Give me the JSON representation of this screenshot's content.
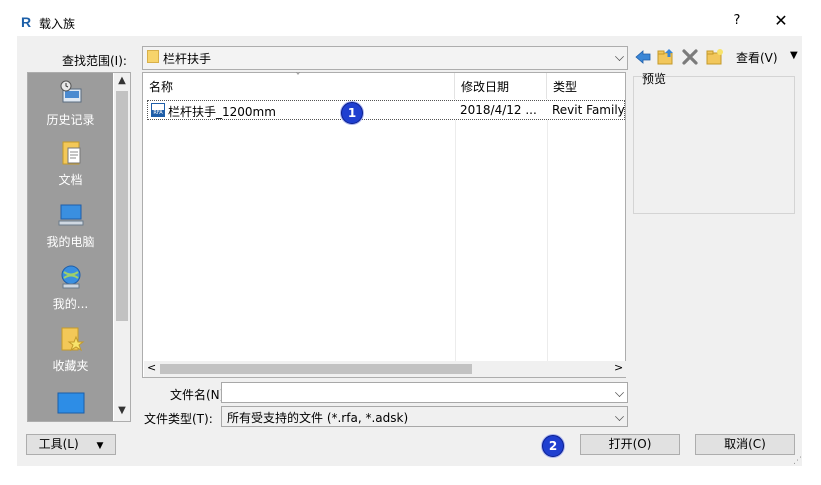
{
  "window": {
    "app_logo": "R",
    "title": "载入族",
    "help": "?",
    "close": "✕"
  },
  "look_in": {
    "label": "查找范围(I):",
    "value": "栏杆扶手"
  },
  "toolbar": {
    "back_icon": "back-arrow-icon",
    "up_icon": "up-folder-icon",
    "delete_icon": "delete-icon",
    "new_folder_icon": "new-folder-icon",
    "views_label": "查看(V)",
    "views_arrow": "▼"
  },
  "places": {
    "items": [
      {
        "label": "历史记录",
        "icon": "history-icon"
      },
      {
        "label": "文档",
        "icon": "documents-icon"
      },
      {
        "label": "我的电脑",
        "icon": "computer-icon"
      },
      {
        "label": "我的...",
        "icon": "network-icon"
      },
      {
        "label": "收藏夹",
        "icon": "favorites-icon"
      },
      {
        "label": "",
        "icon": "desktop-icon"
      }
    ],
    "scroll_up": "▲",
    "scroll_down": "▼"
  },
  "file_list": {
    "columns": [
      {
        "label": "名称"
      },
      {
        "label": "修改日期"
      },
      {
        "label": "类型"
      }
    ],
    "sort_indicator": "ˇ",
    "rows": [
      {
        "name": "栏杆扶手_1200mm",
        "date": "2018/4/12 ...",
        "type": "Revit Family",
        "icon_text": "RFA"
      }
    ],
    "scroll_left": "<",
    "scroll_right": ">"
  },
  "preview": {
    "label": "预览"
  },
  "file_name": {
    "label": "文件名(N):",
    "value": ""
  },
  "file_type": {
    "label": "文件类型(T):",
    "value": "所有受支持的文件 (*.rfa, *.adsk)"
  },
  "buttons": {
    "tools": "工具(L)",
    "tools_arrow": "▼",
    "open": "打开(O)",
    "cancel": "取消(C)"
  },
  "annotations": {
    "badge1": "1",
    "badge2": "2"
  },
  "colors": {
    "badge": "#1f3fd0",
    "places_bg": "#9c9c9c",
    "folder": "#f7d46b",
    "revit_blue": "#1c5fa8"
  }
}
